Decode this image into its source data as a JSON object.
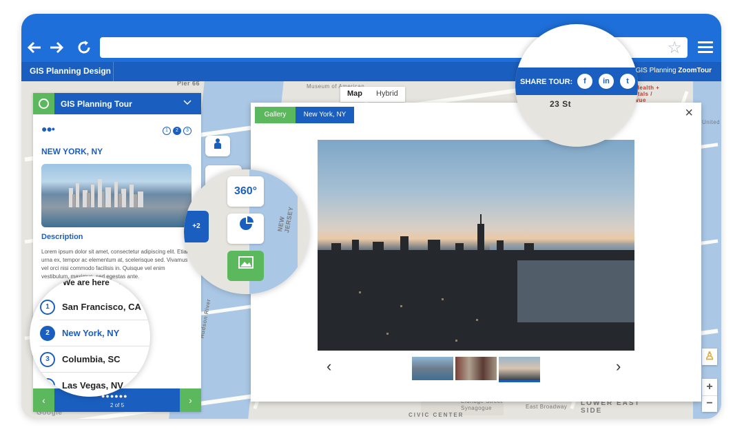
{
  "browser": {
    "back_icon": "arrow-left-icon",
    "forward_icon": "arrow-right-icon",
    "reload_icon": "reload-icon",
    "url": "",
    "bookmark_icon": "star-icon",
    "menu_icon": "hamburger-menu-icon"
  },
  "app": {
    "title": "GIS Planning Design",
    "byline_prefix": "by GIS Planning",
    "byline_brand": "ZoomTour",
    "share_label": "SHARE TOUR:",
    "social": [
      "f",
      "in",
      "t"
    ]
  },
  "map": {
    "type_options": [
      "Map",
      "Hybrid"
    ],
    "selected_type": "Map",
    "labels": [
      "Pier 66",
      "Museum of American",
      "23 St",
      "NYC Health + Hospitals / Bellevue",
      "NEW JERSEY",
      "Hudson River",
      "Eldridge Street",
      "Synagogue",
      "East Broadway",
      "LOWER EAST SIDE",
      "CIVIC CENTER",
      "Google",
      "United"
    ],
    "zoom_in": "+",
    "zoom_out": "−"
  },
  "tour_panel": {
    "title": "GIS Planning Tour",
    "pages": [
      "1",
      "2",
      "3"
    ],
    "current_page": "2",
    "city": "NEW YORK, NY",
    "photo_more": "+2",
    "description_title": "Description",
    "description_text": "Lorem ipsum dolor sit amet, consectetur adipiscing elit. Etiam urna ex, tempor ac elementum at, scelerisque sed. Vivamus vel orci nisi commodo facilisis in. Quisque vel enim vestibulum, maximus, sed egestas ante.",
    "we_are_here": "We are here",
    "list": [
      {
        "num": "1",
        "label": "San Francisco, CA"
      },
      {
        "num": "2",
        "label": "New York, NY"
      },
      {
        "num": "3",
        "label": "Columbia, SC"
      },
      {
        "num": "4",
        "label": "Las Vegas, NV"
      }
    ],
    "footer_count": "2 of 5",
    "prev_label": "‹",
    "next_label": "›"
  },
  "tools": [
    "person-icon",
    "360-icon",
    "pie-chart-icon",
    "image-icon"
  ],
  "tool_360_label": "360°",
  "gallery": {
    "tab_gallery": "Gallery",
    "tab_location": "New York, NY",
    "close_label": "×",
    "prev_label": "‹",
    "next_label": "›",
    "thumbnails": 3,
    "selected_thumbnail": 3
  },
  "colors": {
    "primary_blue": "#1a5fbf",
    "browser_blue": "#1e6fd9",
    "accent_green": "#5cb85c"
  }
}
